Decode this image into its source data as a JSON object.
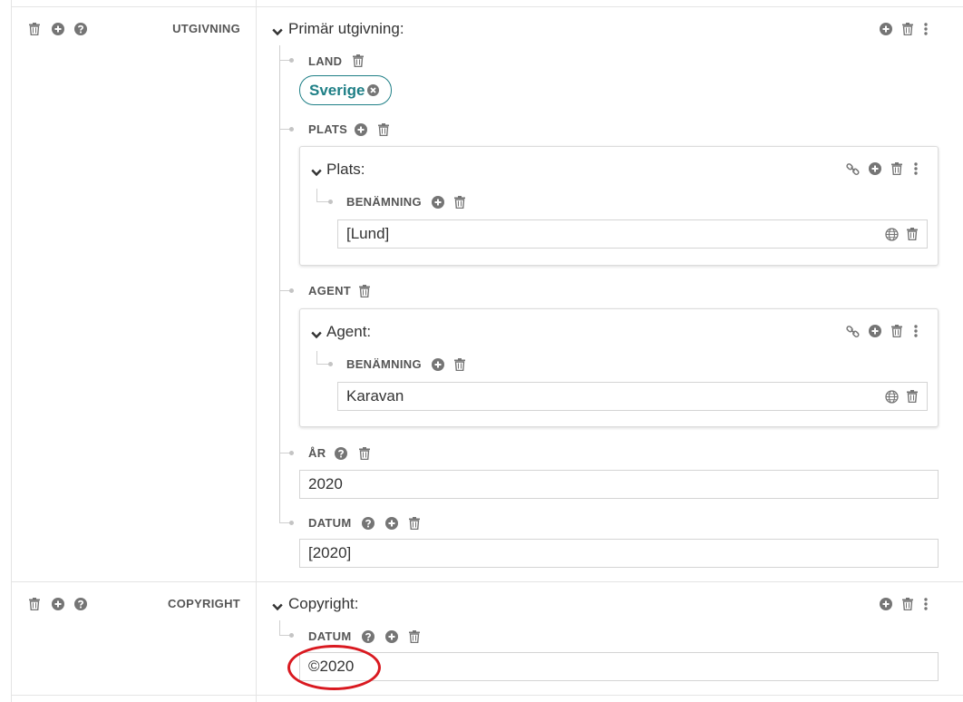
{
  "rows": {
    "utgivning": {
      "label": "UTGIVNING",
      "heading": "Primär utgivning:",
      "properties": {
        "land": {
          "label": "LAND",
          "chip": "Sverige"
        },
        "plats": {
          "label": "PLATS",
          "card_heading": "Plats:",
          "sub_label": "BENÄMNING",
          "value": "[Lund]"
        },
        "agent": {
          "label": "AGENT",
          "card_heading": "Agent:",
          "sub_label": "BENÄMNING",
          "value": "Karavan"
        },
        "ar": {
          "label": "ÅR",
          "value": "2020"
        },
        "datum": {
          "label": "DATUM",
          "value": "[2020]"
        }
      }
    },
    "copyright": {
      "label": "COPYRIGHT",
      "heading": "Copyright:",
      "properties": {
        "datum": {
          "label": "DATUM",
          "value": "©2020"
        }
      }
    }
  },
  "icons": [
    "trash-icon",
    "plus-circle-icon",
    "help-icon",
    "kebab-icon",
    "chevron-down-icon",
    "link-icon",
    "globe-icon",
    "close-circle-icon"
  ],
  "colors": {
    "accent": "#1e7f86",
    "icon": "#757575",
    "highlight_circle": "#d91920"
  }
}
